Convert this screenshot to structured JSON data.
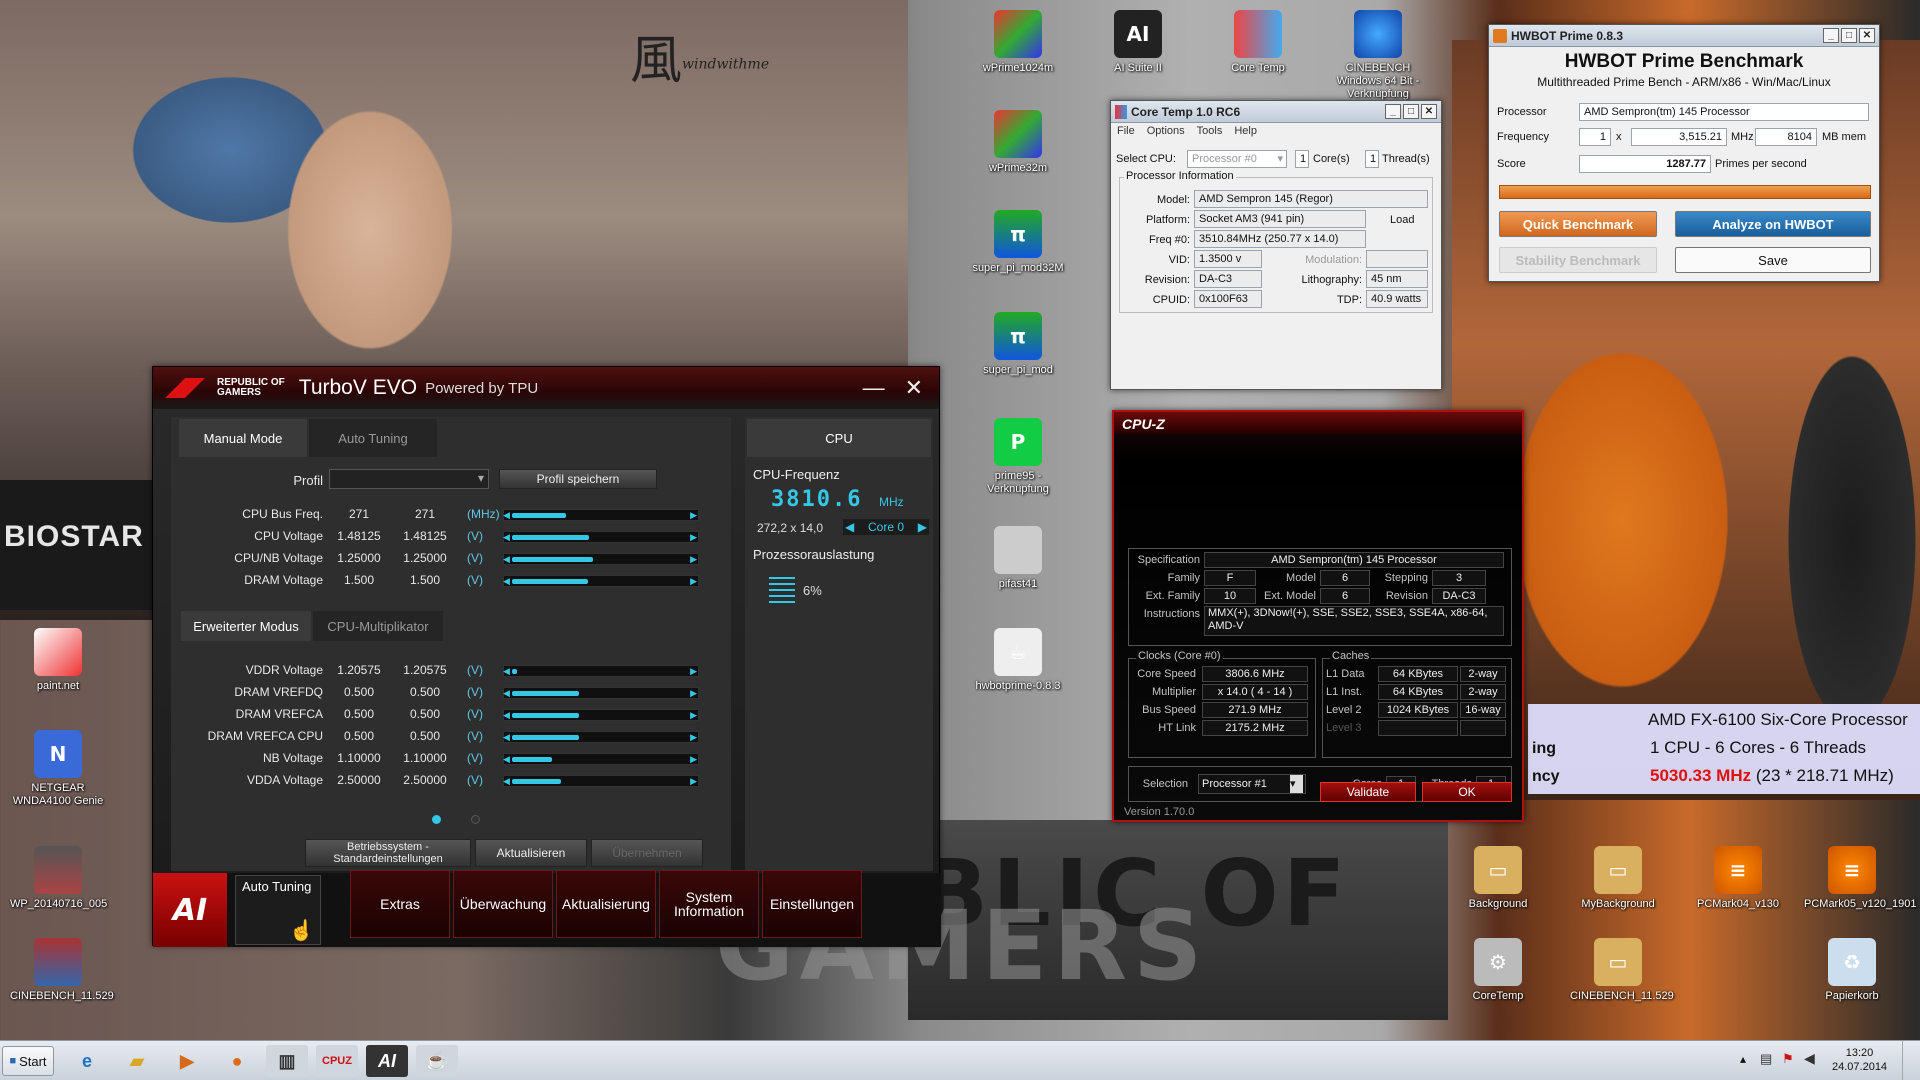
{
  "wallpaper": {
    "brand_text": "BIOSTAR",
    "rog_line1": "BLIC OF",
    "rog_line2": "GAMERS",
    "kanji": "風",
    "kanji_sub": "windwithme"
  },
  "overlay": {
    "cpu_name": "AMD FX-6100 Six-Core Processor",
    "cores_line": "1 CPU - 6 Cores - 6 Threads",
    "freq": "5030.33 MHz",
    "freq_detail": "(23 * 218.71 MHz)",
    "left_cut1": "ing",
    "left_cut2": "ncy",
    "freq_color": "#e01010"
  },
  "desktop_icons": [
    {
      "label": "wPrime1024m",
      "icon": "wprime-icon"
    },
    {
      "label": "AI Suite II",
      "icon": "ai-suite-icon"
    },
    {
      "label": "Core Temp",
      "icon": "thermometer-icon"
    },
    {
      "label": "CINEBENCH Windows 64 Bit - Verknüpfung",
      "icon": "cinebench-icon"
    },
    {
      "label": "wPrime32m",
      "icon": "wprime-icon"
    },
    {
      "label": "super_pi_mod32M",
      "icon": "superpi-icon"
    },
    {
      "label": "super_pi_mod",
      "icon": "superpi-icon"
    },
    {
      "label": "prime95 - Verknüpfung",
      "icon": "prime95-icon"
    },
    {
      "label": "pifast41",
      "icon": "pifast-icon"
    },
    {
      "label": "hwbotprime-0.8.3",
      "icon": "java-icon"
    },
    {
      "label": "paint.net",
      "icon": "paint-icon"
    },
    {
      "label": "NETGEAR WNDA4100 Genie",
      "icon": "netgear-icon"
    },
    {
      "label": "WP_20140716_005",
      "icon": "image-icon"
    },
    {
      "label": "CINEBENCH_11.529",
      "icon": "winrar-icon"
    },
    {
      "label": "Background",
      "icon": "folder-icon"
    },
    {
      "label": "MyBackground",
      "icon": "folder-icon"
    },
    {
      "label": "PCMark04_v130",
      "icon": "pcmark-icon"
    },
    {
      "label": "PCMark05_v120_1901",
      "icon": "pcmark-icon"
    },
    {
      "label": "CoreTemp",
      "icon": "gear-icon"
    },
    {
      "label": "CINEBENCH_11.529",
      "icon": "folder-icon"
    },
    {
      "label": "Papierkorb",
      "icon": "recycle-bin-icon"
    }
  ],
  "hwbot": {
    "window_title": "HWBOT Prime 0.8.3",
    "heading": "HWBOT Prime Benchmark",
    "subheading": "Multithreaded Prime Bench - ARM/x86 - Win/Mac/Linux",
    "processor_label": "Processor",
    "processor_value": "AMD Sempron(tm) 145 Processor",
    "frequency_label": "Frequency",
    "freq_count": "1",
    "freq_x": "x",
    "freq_value": "3,515.21",
    "mhz_label": "MHz",
    "mem_value": "8104",
    "mem_label": "MB mem",
    "score_label": "Score",
    "score_value": "1287.77",
    "score_unit": "Primes per second",
    "quick_button": "Quick Benchmark",
    "analyze_button": "Analyze on HWBOT",
    "stability_button": "Stability Benchmark",
    "save_button": "Save",
    "progress": 1.0
  },
  "coretemp": {
    "window_title": "Core Temp 1.0 RC6",
    "menu": [
      "File",
      "Options",
      "Tools",
      "Help"
    ],
    "select_cpu_label": "Select CPU:",
    "select_cpu_value": "Processor #0",
    "cores_count": "1",
    "cores_label": "Core(s)",
    "threads_count": "1",
    "threads_label": "Thread(s)",
    "group_title": "Processor Information",
    "model_label": "Model:",
    "model_value": "AMD Sempron 145 (Regor)",
    "platform_label": "Platform:",
    "platform_value": "Socket AM3 (941 pin)",
    "load_label": "Load",
    "freq_label": "Freq #0:",
    "freq_value": "3510.84MHz (250.77 x 14.0)",
    "vid_label": "VID:",
    "vid_value": "1.3500 v",
    "modulation_label": "Modulation:",
    "revision_label": "Revision:",
    "revision_value": "DA-C3",
    "litho_label": "Lithography:",
    "litho_value": "45 nm",
    "cpuid_label": "CPUID:",
    "cpuid_value": "0x100F63",
    "tdp_label": "TDP:",
    "tdp_value": "40.9 watts"
  },
  "cpuz": {
    "title": "CPU-Z",
    "spec_label": "Specification",
    "spec_value": "AMD Sempron(tm) 145 Processor",
    "family_label": "Family",
    "family_value": "F",
    "model_label": "Model",
    "model_value": "6",
    "stepping_label": "Stepping",
    "stepping_value": "3",
    "extfamily_label": "Ext. Family",
    "extfamily_value": "10",
    "extmodel_label": "Ext. Model",
    "extmodel_value": "6",
    "revision_label": "Revision",
    "revision_value": "DA-C3",
    "instructions_label": "Instructions",
    "instructions_value": "MMX(+), 3DNow!(+), SSE, SSE2, SSE3, SSE4A, x86-64, AMD-V",
    "clocks_title": "Clocks (Core #0)",
    "caches_title": "Caches",
    "corespeed_label": "Core Speed",
    "corespeed_value": "3806.6 MHz",
    "multiplier_label": "Multiplier",
    "multiplier_value": "x 14.0 ( 4 - 14 )",
    "busspeed_label": "Bus Speed",
    "busspeed_value": "271.9 MHz",
    "htlink_label": "HT Link",
    "htlink_value": "2175.2 MHz",
    "l1data_label": "L1 Data",
    "l1data_value": "64 KBytes",
    "l1data_way": "2-way",
    "l1inst_label": "L1 Inst.",
    "l1inst_value": "64 KBytes",
    "l1inst_way": "2-way",
    "level2_label": "Level 2",
    "level2_value": "1024 KBytes",
    "level2_way": "16-way",
    "level3_label": "Level 3",
    "selection_label": "Selection",
    "selection_value": "Processor #1",
    "cores_label": "Cores",
    "cores_value": "1",
    "threads_label": "Threads",
    "threads_value": "1",
    "validate_button": "Validate",
    "ok_button": "OK",
    "version": "Version 1.70.0"
  },
  "turbov": {
    "brand_line1": "REPUBLIC OF",
    "brand_line2": "GAMERS",
    "app_title": "TurboV EVO",
    "subtitle": "Powered by TPU",
    "tab_manual": "Manual Mode",
    "tab_auto": "Auto Tuning",
    "profile_label": "Profil",
    "profile_save_button": "Profil speichern",
    "rows_top": [
      {
        "label": "CPU Bus Freq.",
        "v1": "271",
        "v2": "271",
        "unit": "(MHz)",
        "level": 0.3
      },
      {
        "label": "CPU Voltage",
        "v1": "1.48125",
        "v2": "1.48125",
        "unit": "(V)",
        "level": 0.43
      },
      {
        "label": "CPU/NB Voltage",
        "v1": "1.25000",
        "v2": "1.25000",
        "unit": "(V)",
        "level": 0.45
      },
      {
        "label": "DRAM Voltage",
        "v1": "1.500",
        "v2": "1.500",
        "unit": "(V)",
        "level": 0.42
      }
    ],
    "tab_extended": "Erweiterter Modus",
    "tab_multiplier": "CPU-Multiplikator",
    "rows_ext": [
      {
        "label": "VDDR Voltage",
        "v1": "1.20575",
        "v2": "1.20575",
        "unit": "(V)",
        "level": 0.03
      },
      {
        "label": "DRAM VREFDQ",
        "v1": "0.500",
        "v2": "0.500",
        "unit": "(V)",
        "level": 0.37
      },
      {
        "label": "DRAM VREFCA",
        "v1": "0.500",
        "v2": "0.500",
        "unit": "(V)",
        "level": 0.37
      },
      {
        "label": "DRAM VREFCA CPU",
        "v1": "0.500",
        "v2": "0.500",
        "unit": "(V)",
        "level": 0.37
      },
      {
        "label": "NB Voltage",
        "v1": "1.10000",
        "v2": "1.10000",
        "unit": "(V)",
        "level": 0.22
      },
      {
        "label": "VDDA Voltage",
        "v1": "2.50000",
        "v2": "2.50000",
        "unit": "(V)",
        "level": 0.27
      }
    ],
    "btn_defaults": "Betriebssystem -Standardeinstellungen",
    "btn_update": "Aktualisieren",
    "btn_apply": "Übernehmen",
    "cpu_panel_title": "CPU",
    "cpu_freq_label": "CPU-Frequenz",
    "cpu_freq_value": "3810.6",
    "cpu_freq_unit": "MHz",
    "cpu_ratio": "272,2 x 14,0",
    "core_selector": "Core 0",
    "usage_label": "Prozessorauslastung",
    "usage_value": "6%",
    "nav": [
      "Auto Tuning",
      "Extras",
      "Überwachung",
      "Aktualisierung",
      "System Information",
      "Einstellungen"
    ]
  },
  "taskbar": {
    "start": "Start",
    "time": "13:20",
    "date": "24.07.2014"
  }
}
